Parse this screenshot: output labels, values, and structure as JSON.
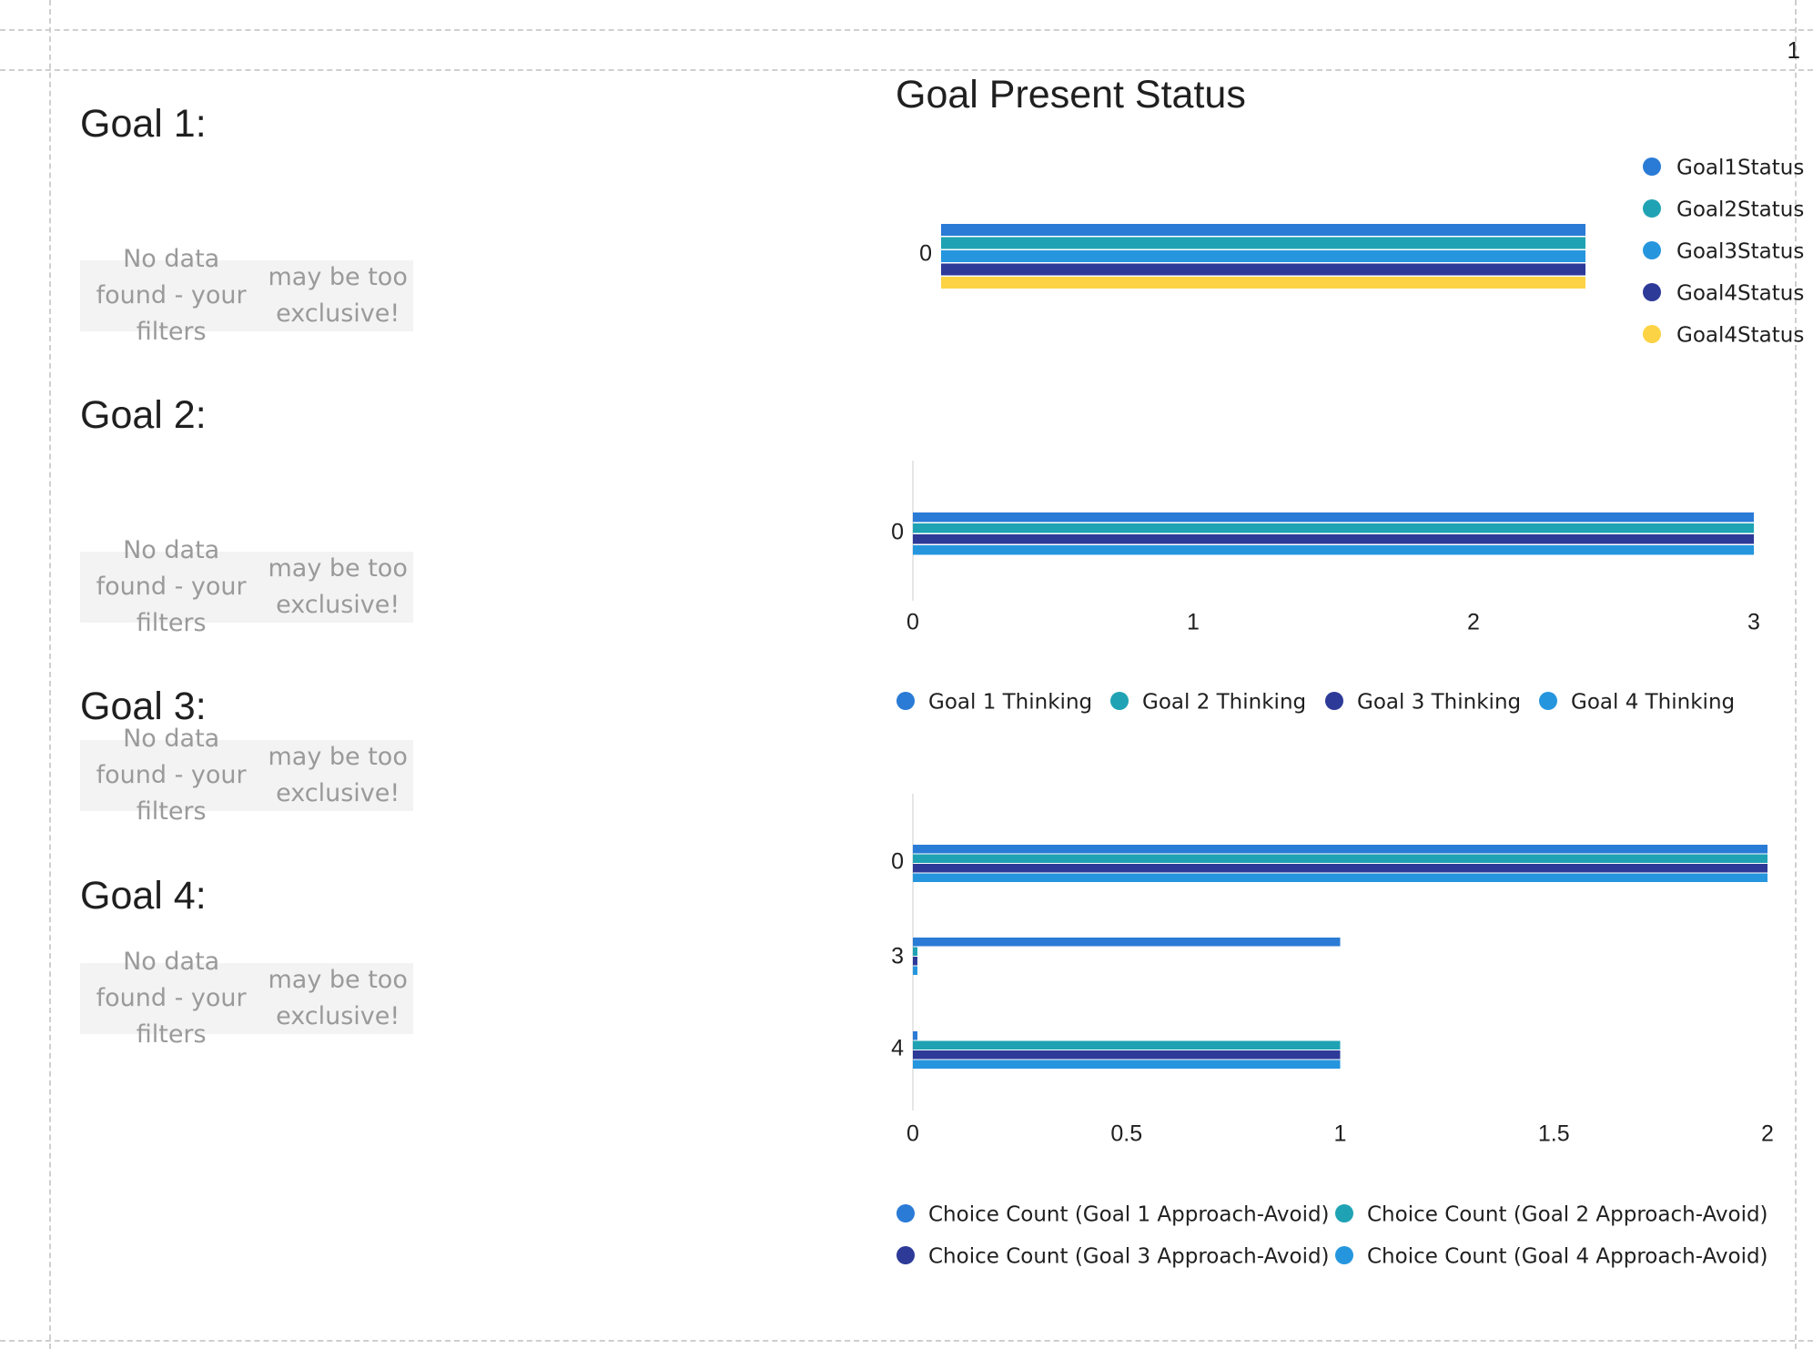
{
  "page": {
    "number": "1"
  },
  "goals": [
    {
      "title": "Goal 1:",
      "empty_line1": "No data found - your filters",
      "empty_line2": "may be too exclusive!"
    },
    {
      "title": "Goal 2:",
      "empty_line1": "No data found - your filters",
      "empty_line2": "may be too exclusive!"
    },
    {
      "title": "Goal 3:",
      "empty_line1": "No data found - your filters",
      "empty_line2": "may be too exclusive!"
    },
    {
      "title": "Goal 4:",
      "empty_line1": "No data found - your filters",
      "empty_line2": "may be too exclusive!"
    }
  ],
  "colors": {
    "blue": "#2a7bd6",
    "teal": "#1fa3b4",
    "light_blue": "#2596de",
    "navy": "#2d3a98",
    "yellow": "#fcd344",
    "axis": "#e6e6e6"
  },
  "chart_data": [
    {
      "type": "bar",
      "orientation": "horizontal",
      "title": "Goal Present Status",
      "categories": [
        "0"
      ],
      "series": [
        {
          "name": "Goal1Status",
          "color": "#2a7bd6",
          "values": [
            1
          ]
        },
        {
          "name": "Goal2Status",
          "color": "#1fa3b4",
          "values": [
            1
          ]
        },
        {
          "name": "Goal3Status",
          "color": "#2596de",
          "values": [
            1
          ]
        },
        {
          "name": "Goal4Status",
          "color": "#2d3a98",
          "values": [
            1
          ]
        },
        {
          "name": "Goal4Status",
          "color": "#fcd344",
          "values": [
            1
          ]
        }
      ],
      "legend_position": "right",
      "xaxis_visible": false
    },
    {
      "type": "bar",
      "orientation": "horizontal",
      "categories": [
        "0"
      ],
      "series": [
        {
          "name": "Goal 1 Thinking",
          "color": "#2a7bd6",
          "values": [
            3
          ]
        },
        {
          "name": "Goal 2 Thinking",
          "color": "#1fa3b4",
          "values": [
            3
          ]
        },
        {
          "name": "Goal 3 Thinking",
          "color": "#2d3a98",
          "values": [
            3
          ]
        },
        {
          "name": "Goal 4 Thinking",
          "color": "#2596de",
          "values": [
            3
          ]
        }
      ],
      "xlim": [
        0,
        3
      ],
      "xticks": [
        "0",
        "1",
        "2",
        "3"
      ],
      "legend_position": "bottom"
    },
    {
      "type": "bar",
      "orientation": "horizontal",
      "categories": [
        "0",
        "3",
        "4"
      ],
      "series": [
        {
          "name": "Choice Count (Goal 1 Approach-Avoid)",
          "color": "#2a7bd6",
          "values": [
            2,
            1,
            0
          ]
        },
        {
          "name": "Choice Count (Goal 2 Approach-Avoid)",
          "color": "#1fa3b4",
          "values": [
            2,
            0,
            1
          ]
        },
        {
          "name": "Choice Count (Goal 3 Approach-Avoid)",
          "color": "#2d3a98",
          "values": [
            2,
            0,
            1
          ]
        },
        {
          "name": "Choice Count (Goal 4 Approach-Avoid)",
          "color": "#2596de",
          "values": [
            2,
            0,
            1
          ]
        }
      ],
      "xlim": [
        0,
        2
      ],
      "xticks": [
        "0",
        "0.5",
        "1",
        "1.5",
        "2"
      ],
      "legend_position": "bottom"
    }
  ]
}
